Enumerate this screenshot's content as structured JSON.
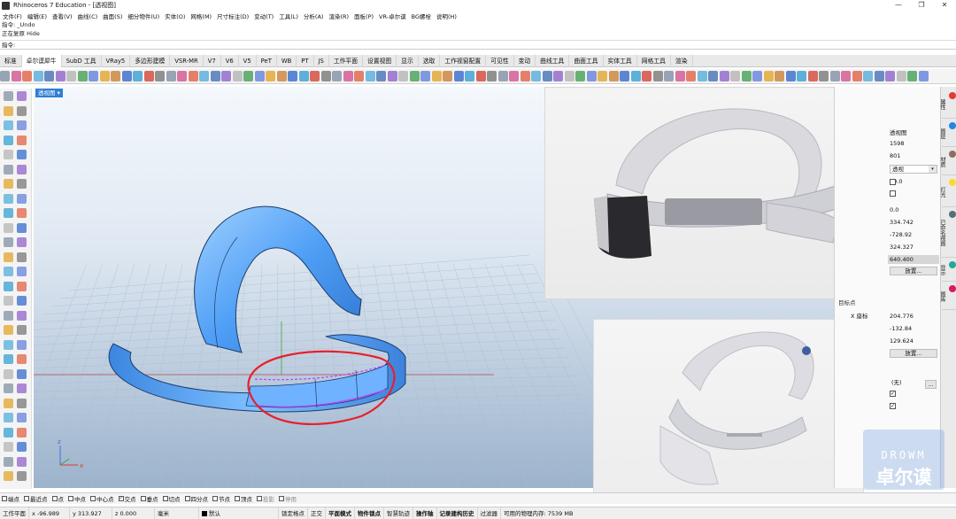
{
  "title": "Rhinoceros 7 Education - [透视图]",
  "window_controls": [
    "—",
    "❐",
    "✕"
  ],
  "menu": [
    "文件(F)",
    "编辑(E)",
    "查看(V)",
    "曲线(C)",
    "曲面(S)",
    "细分物件(U)",
    "实体(O)",
    "网格(M)",
    "尺寸标注(D)",
    "变动(T)",
    "工具(L)",
    "分析(A)",
    "渲染(R)",
    "面板(P)",
    "VR-卓尔谟",
    "BG螺栓",
    "说明(H)"
  ],
  "command_history": [
    "指令: _Undo",
    "正在复原 Hide"
  ],
  "command_prompt": "指令:",
  "tabs": [
    "标准",
    "卓尔谟犀牛",
    "SubD 工具",
    "VRay5",
    "多边形建模",
    "VSR-MR",
    "V7",
    "V6",
    "V5",
    "PeT",
    "WB",
    "PT",
    "JS",
    "工作平面",
    "设置视图",
    "显示",
    "选取",
    "工作视窗配置",
    "可见性",
    "变动",
    "曲线工具",
    "曲面工具",
    "实体工具",
    "网格工具",
    "渲染"
  ],
  "active_tab": "卓尔谟犀牛",
  "viewport_label": "透视图",
  "properties": {
    "rows": [
      {
        "label": "",
        "value": "透视图"
      },
      {
        "label": "",
        "value": "1598"
      },
      {
        "label": "",
        "value": "801"
      },
      {
        "label": "",
        "value": "透视"
      },
      {
        "label": "",
        "value": "50.0"
      },
      {
        "label": "",
        "value": "0.0"
      },
      {
        "label": "",
        "value": "334.742"
      },
      {
        "label": "",
        "value": "-728.92"
      },
      {
        "label": "",
        "value": "324.327"
      },
      {
        "label": "",
        "value": "640.400"
      },
      {
        "label": "",
        "value": "放置..."
      },
      {
        "label": "X 座标",
        "value": "204.776"
      },
      {
        "label": "",
        "value": "-132.84"
      },
      {
        "label": "",
        "value": "129.624"
      },
      {
        "label": "",
        "value": "放置..."
      },
      {
        "label": "",
        "value": "(无)"
      }
    ],
    "section_label": "目标点"
  },
  "right_tabs": [
    "属性",
    "图层",
    "材质",
    "灯光",
    "已命名视图",
    "显示",
    "图库"
  ],
  "osnaps": [
    {
      "label": "端点",
      "checked": false
    },
    {
      "label": "最近点",
      "checked": false
    },
    {
      "label": "点",
      "checked": false
    },
    {
      "label": "中点",
      "checked": false
    },
    {
      "label": "中心点",
      "checked": false
    },
    {
      "label": "交点",
      "checked": true
    },
    {
      "label": "垂点",
      "checked": false
    },
    {
      "label": "切点",
      "checked": false
    },
    {
      "label": "四分点",
      "checked": false
    },
    {
      "label": "节点",
      "checked": false
    },
    {
      "label": "顶点",
      "checked": false
    },
    {
      "label": "投影",
      "checked": false,
      "disabled": true
    },
    {
      "label": "停用",
      "checked": false,
      "disabled": true
    }
  ],
  "status": {
    "cplane": "工作平面",
    "x": "x -96.989",
    "y": "y 313.927",
    "z": "z 0.000",
    "units": "毫米",
    "layer": "默认",
    "items": [
      "锁定格点",
      "正交",
      "平面模式",
      "物件锁点",
      "智慧轨迹",
      "操作轴",
      "记录建构历史",
      "过滤器"
    ],
    "bold_items": [
      "平面模式",
      "物件锁点",
      "操作轴",
      "记录建构历史"
    ],
    "memory": "可用的物理内存: 7539 MB"
  },
  "watermark": {
    "line1": "DROWM",
    "line2": "卓尔谟"
  },
  "colors": {
    "accent": "#2f7fd5",
    "selection_circle": "#e8202a",
    "model_blue": "#5aa9ff"
  }
}
